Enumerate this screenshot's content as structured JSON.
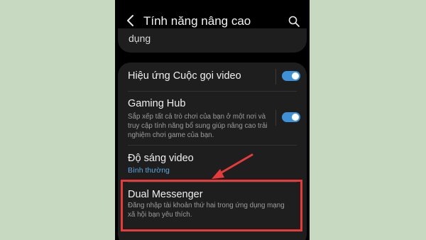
{
  "header": {
    "title": "Tính năng nâng cao",
    "back_icon": "arrow-left-icon",
    "search_icon": "search-icon"
  },
  "previous_item": {
    "text": "dụng"
  },
  "settings": [
    {
      "title": "Hiệu ứng Cuộc gọi video",
      "toggle_on": true
    },
    {
      "title": "Gaming Hub",
      "description": "Sắp xếp tất cả trò chơi của bạn ở một nơi và truy cập tính năng bổ sung giúp nâng cao trải nghiệm chơi game của bạn.",
      "toggle_on": true
    },
    {
      "title": "Độ sáng video",
      "status": "Bình thường"
    },
    {
      "title": "Dual Messenger",
      "description": "Đăng nhập tài khoản thứ hai trong ứng dụng mạng xã hội bạn yêu thích."
    }
  ],
  "colors": {
    "page_background": "#c7d9c0",
    "toggle_on": "#3e91d4",
    "status_text": "#5ba6dc",
    "annotation": "#e53b3b"
  }
}
